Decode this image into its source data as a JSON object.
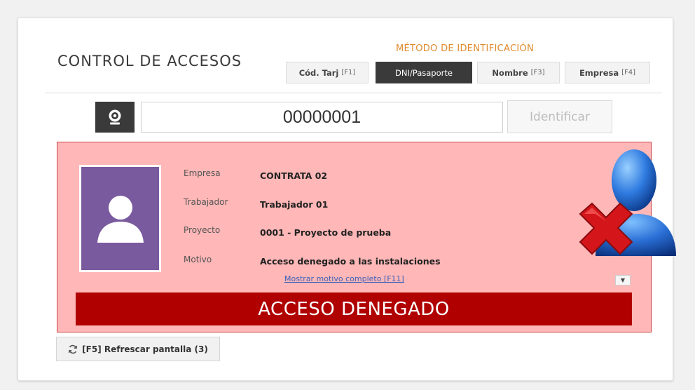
{
  "header": {
    "title": "CONTROL DE ACCESOS",
    "method_label": "MÉTODO DE IDENTIFICACIÓN",
    "methods": [
      {
        "label": "Cód. Tarj",
        "key": "[F1]"
      },
      {
        "label": "DNI/Pasaporte",
        "key": ""
      },
      {
        "label": "Nombre",
        "key": "[F3]"
      },
      {
        "label": "Empresa",
        "key": "[F4]"
      }
    ]
  },
  "search": {
    "value": "00000001",
    "identify_label": "Identificar"
  },
  "result": {
    "fields": [
      {
        "label": "Empresa",
        "value": "CONTRATA 02"
      },
      {
        "label": "Trabajador",
        "value": "Trabajador 01"
      },
      {
        "label": "Proyecto",
        "value": "0001 - Proyecto de prueba"
      },
      {
        "label": "Motivo",
        "value": "Acceso denegado a las instalaciones"
      }
    ],
    "more_link": "Mostrar motivo completo [F11]",
    "status": "ACCESO DENEGADO"
  },
  "footer": {
    "refresh_label": "[F5] Refrescar pantalla (3)"
  },
  "icons": {
    "camera": "webcam-icon",
    "photo": "user-silhouette-icon",
    "status": "user-denied-icon",
    "refresh": "refresh-icon",
    "expand": "chevron-down-icon"
  },
  "colors": {
    "accent": "#e08a2c",
    "denied_bg": "#ffb7b7",
    "denied_bar": "#b00000",
    "active_method": "#3a3a3a",
    "photo_bg": "#7a5a9e"
  }
}
